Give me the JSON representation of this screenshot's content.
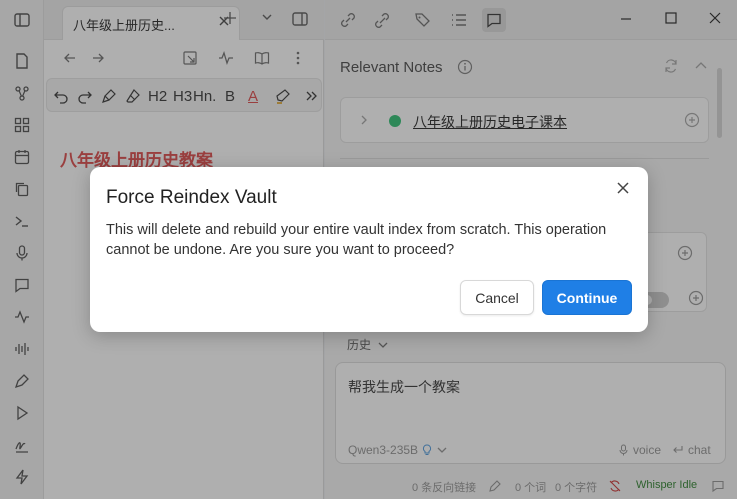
{
  "left_pane": {
    "tab_title": "八年级上册历史...",
    "document_heading": "八年级上册历史教案",
    "format_bar": {
      "h2": "H2",
      "h3": "H3",
      "hn": "Hn.",
      "bold": "B",
      "font_color": "A"
    },
    "format_accent_color": "#e05555"
  },
  "right_pane": {
    "relevant_notes_title": "Relevant Notes",
    "note_title": "八年级上册历史电子课本",
    "note_status_color": "#3cc47c",
    "history_label": "历史",
    "chat_input_text": "帮我生成一个教案",
    "model_name": "Qwen3-235B",
    "voice_label": "voice",
    "chat_label": "chat"
  },
  "status_bar": {
    "backlinks": "0 条反向链接",
    "words": "0 个词",
    "characters": "0 个字符",
    "whisper_status": "Whisper Idle"
  },
  "modal": {
    "title": "Force Reindex Vault",
    "message": "This will delete and rebuild your entire vault index from scratch. This operation cannot be undone. Are you sure you want to proceed?",
    "cancel_label": "Cancel",
    "continue_label": "Continue",
    "primary_color": "#1f7fe6"
  }
}
